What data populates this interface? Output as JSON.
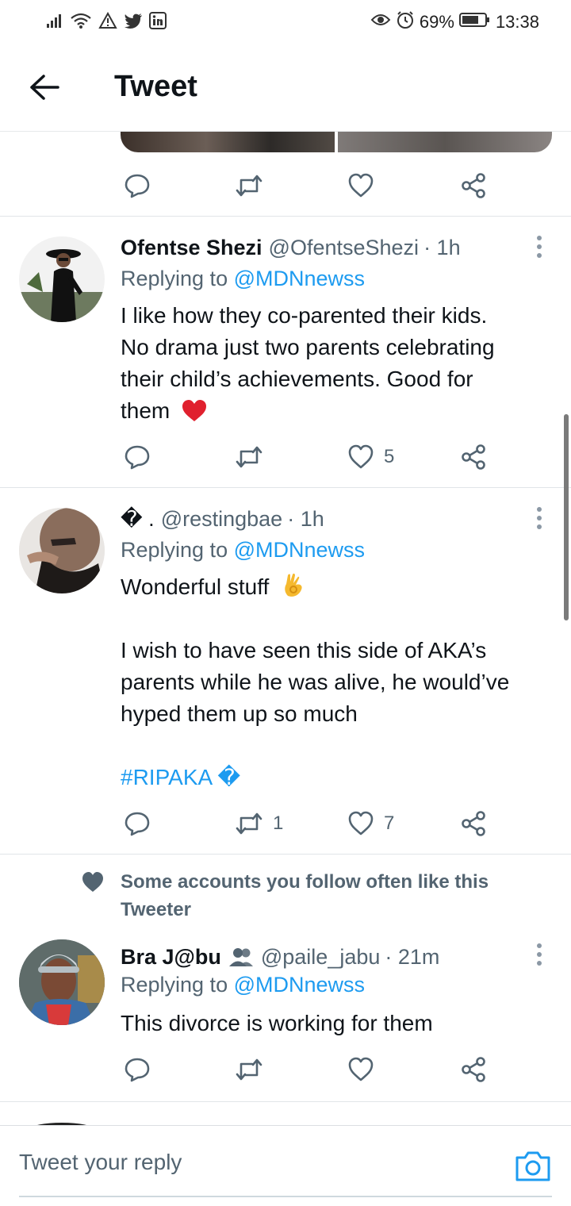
{
  "status_bar": {
    "battery": "69%",
    "time": "13:38",
    "icons": [
      "signal-icon",
      "wifi-icon",
      "warning-icon",
      "twitter-bird-icon",
      "linkedin-icon",
      "eye-icon",
      "alarm-icon",
      "battery-icon"
    ]
  },
  "header": {
    "title": "Tweet",
    "back_icon": "arrow-left-icon"
  },
  "tweets": [
    {
      "name": "Ofentse Shezi",
      "handle": "@OfentseShezi",
      "time": "· 1h",
      "replying_prefix": "Replying to",
      "replying_to": "@MDNnewss",
      "text_lines": [
        "I like how they co-parented their kids.",
        "No drama just two parents celebrating",
        "their child’s achievements. Good for",
        "them"
      ],
      "emoji": "heart",
      "replies": "",
      "retweets": "",
      "likes": "5"
    },
    {
      "name": "� .",
      "handle": "@restingbae",
      "time": "· 1h",
      "replying_prefix": "Replying to",
      "replying_to": "@MDNnewss",
      "text_lines": [
        "Wonderful stuff",
        "",
        "I wish to have seen this side of AKA’s",
        "parents while he was alive, he would’ve",
        "hyped them up so much",
        "",
        "#RIPAKA �"
      ],
      "emoji": "ok-hand",
      "replies": "",
      "retweets": "1",
      "likes": "7"
    },
    {
      "social_context": "Some accounts you follow often like this Tweeter",
      "name": "Bra J@bu",
      "handle": "@paile_jabu",
      "time": "· 21m",
      "replying_prefix": "Replying to",
      "replying_to": "@MDNnewss",
      "text_lines": [
        "This divorce is working for them"
      ],
      "replies": "",
      "retweets": "",
      "likes": ""
    }
  ],
  "composer": {
    "placeholder": "Tweet your reply",
    "camera_icon": "camera-icon"
  },
  "colors": {
    "link": "#1d9bf0",
    "secondary_text": "#536471",
    "primary_text": "#0f1419"
  }
}
